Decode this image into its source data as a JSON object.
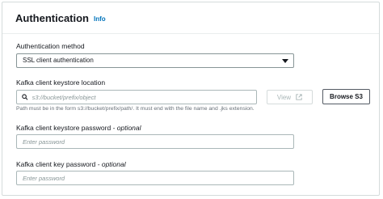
{
  "panel": {
    "title": "Authentication",
    "info_link": "Info"
  },
  "auth_method": {
    "label": "Authentication method",
    "selected": "SSL client authentication"
  },
  "keystore_location": {
    "label": "Kafka client keystore location",
    "placeholder": "s3://bucket/prefix/object",
    "view_label": "View",
    "browse_label": "Browse S3",
    "hint": "Path must be in the form s3://bucket/prefix/path/. It must end with the file name and .jks extension."
  },
  "keystore_password": {
    "label": "Kafka client keystore password",
    "optional": "- optional",
    "placeholder": "Enter password"
  },
  "key_password": {
    "label": "Kafka client key password",
    "optional": "- optional",
    "placeholder": "Enter password"
  },
  "colors": {
    "link": "#0073bb",
    "border": "#aab7b8",
    "text": "#16191f"
  },
  "icons": [
    "search-icon",
    "external-link-icon",
    "caret-down-icon"
  ]
}
